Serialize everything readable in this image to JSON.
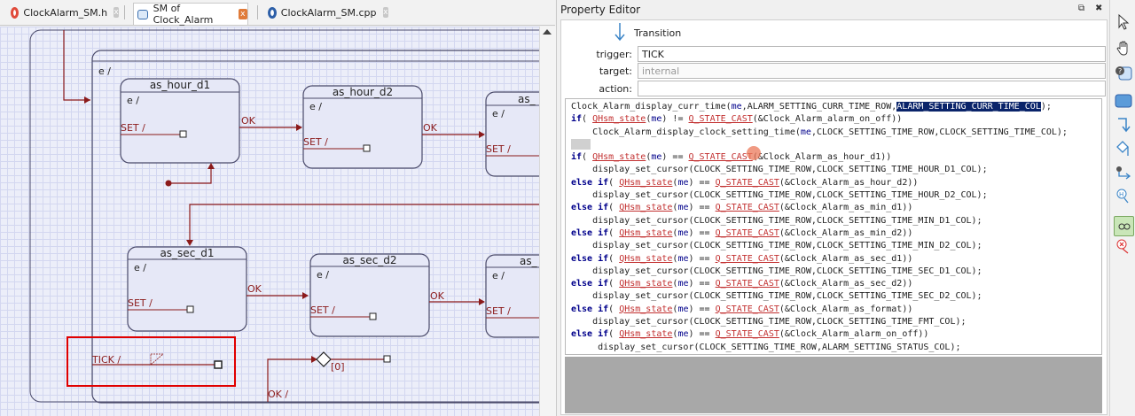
{
  "tabs": [
    {
      "label": "ClockAlarm_SM.h",
      "icon": "c-header-file-icon",
      "close": "x"
    },
    {
      "label": "SM of Clock_Alarm",
      "icon": "state-machine-icon",
      "close": "x"
    },
    {
      "label": "ClockAlarm_SM.cpp",
      "icon": "cpp-file-icon",
      "close": "x"
    }
  ],
  "diagram": {
    "outer_entry": "e /",
    "states": [
      {
        "name": "as_hour_d1",
        "entry": "e /",
        "set": "SET /"
      },
      {
        "name": "as_hour_d2",
        "entry": "e /",
        "set": "SET /"
      },
      {
        "name": "as_",
        "entry": "e /",
        "set": "SET /"
      },
      {
        "name": "as_sec_d1",
        "entry": "e /",
        "set": "SET /"
      },
      {
        "name": "as_sec_d2",
        "entry": "e /",
        "set": "SET /"
      },
      {
        "name": "as_",
        "entry": "e /",
        "set": "SET /"
      }
    ],
    "ok_labels": [
      "OK",
      "OK",
      "OK",
      "OK"
    ],
    "tick_label": "TICK /",
    "guard_label": "[0]",
    "bottom_label": "OK /"
  },
  "property_editor": {
    "title": "Property Editor",
    "restore": "⧉",
    "close": "✖",
    "element_type": "Transition",
    "trigger_label": "trigger:",
    "trigger_value": "TICK",
    "target_label": "target:",
    "target_value": "internal",
    "action_label": "action:",
    "action_value": ""
  },
  "code_lines": [
    [
      {
        "t": "Clock_Alarm_display_curr_time("
      },
      {
        "t": "me",
        "c": "me"
      },
      {
        "t": ",ALARM_SETTING_CURR_TIME_ROW,"
      },
      {
        "t": "ALARM_SETTING_CURR_TIME_COL",
        "c": "hl"
      },
      {
        "t": ");"
      }
    ],
    [
      {
        "t": "if",
        "c": "kw"
      },
      {
        "t": "( "
      },
      {
        "t": "QHsm_state",
        "c": "fn"
      },
      {
        "t": "("
      },
      {
        "t": "me",
        "c": "me"
      },
      {
        "t": ") != "
      },
      {
        "t": "Q_STATE_CAST",
        "c": "fn"
      },
      {
        "t": "(&Clock_Alarm_alarm_on_off))"
      }
    ],
    [
      {
        "t": "    Clock_Alarm_display_clock_setting_time("
      },
      {
        "t": "me",
        "c": "me"
      },
      {
        "t": ",CLOCK_SETTING_TIME_ROW,CLOCK_SETTING_TIME_COL);"
      }
    ],
    [
      {
        "t": "",
        "c": "blank"
      }
    ],
    [
      {
        "t": "if",
        "c": "kw"
      },
      {
        "t": "( "
      },
      {
        "t": "QHsm_state",
        "c": "fn"
      },
      {
        "t": "("
      },
      {
        "t": "me",
        "c": "me"
      },
      {
        "t": ") == "
      },
      {
        "t": "Q_STATE_CAST",
        "c": "fn"
      },
      {
        "t": "(&Clock_Alarm_as_hour_d1))"
      }
    ],
    [
      {
        "t": "    display_set_cursor(CLOCK_SETTING_TIME_ROW,CLOCK_SETTING_TIME_HOUR_D1_COL);"
      }
    ],
    [
      {
        "t": "else if",
        "c": "kw"
      },
      {
        "t": "( "
      },
      {
        "t": "QHsm_state",
        "c": "fn"
      },
      {
        "t": "("
      },
      {
        "t": "me",
        "c": "me"
      },
      {
        "t": ") == "
      },
      {
        "t": "Q_STATE_CAST",
        "c": "fn"
      },
      {
        "t": "(&Clock_Alarm_as_hour_d2))"
      }
    ],
    [
      {
        "t": "    display_set_cursor(CLOCK_SETTING_TIME_ROW,CLOCK_SETTING_TIME_HOUR_D2_COL);"
      }
    ],
    [
      {
        "t": "else if",
        "c": "kw"
      },
      {
        "t": "( "
      },
      {
        "t": "QHsm_state",
        "c": "fn"
      },
      {
        "t": "("
      },
      {
        "t": "me",
        "c": "me"
      },
      {
        "t": ") == "
      },
      {
        "t": "Q_STATE_CAST",
        "c": "fn"
      },
      {
        "t": "(&Clock_Alarm_as_min_d1))"
      }
    ],
    [
      {
        "t": "    display_set_cursor(CLOCK_SETTING_TIME_ROW,CLOCK_SETTING_TIME_MIN_D1_COL);"
      }
    ],
    [
      {
        "t": "else if",
        "c": "kw"
      },
      {
        "t": "( "
      },
      {
        "t": "QHsm_state",
        "c": "fn"
      },
      {
        "t": "("
      },
      {
        "t": "me",
        "c": "me"
      },
      {
        "t": ") == "
      },
      {
        "t": "Q_STATE_CAST",
        "c": "fn"
      },
      {
        "t": "(&Clock_Alarm_as_min_d2))"
      }
    ],
    [
      {
        "t": "    display_set_cursor(CLOCK_SETTING_TIME_ROW,CLOCK_SETTING_TIME_MIN_D2_COL);"
      }
    ],
    [
      {
        "t": "else if",
        "c": "kw"
      },
      {
        "t": "( "
      },
      {
        "t": "QHsm_state",
        "c": "fn"
      },
      {
        "t": "("
      },
      {
        "t": "me",
        "c": "me"
      },
      {
        "t": ") == "
      },
      {
        "t": "Q_STATE_CAST",
        "c": "fn"
      },
      {
        "t": "(&Clock_Alarm_as_sec_d1))"
      }
    ],
    [
      {
        "t": "    display_set_cursor(CLOCK_SETTING_TIME_ROW,CLOCK_SETTING_TIME_SEC_D1_COL);"
      }
    ],
    [
      {
        "t": "else if",
        "c": "kw"
      },
      {
        "t": "( "
      },
      {
        "t": "QHsm_state",
        "c": "fn"
      },
      {
        "t": "("
      },
      {
        "t": "me",
        "c": "me"
      },
      {
        "t": ") == "
      },
      {
        "t": "Q_STATE_CAST",
        "c": "fn"
      },
      {
        "t": "(&Clock_Alarm_as_sec_d2))"
      }
    ],
    [
      {
        "t": "    display_set_cursor(CLOCK_SETTING_TIME_ROW,CLOCK_SETTING_TIME_SEC_D2_COL);"
      }
    ],
    [
      {
        "t": "else if",
        "c": "kw"
      },
      {
        "t": "( "
      },
      {
        "t": "QHsm_state",
        "c": "fn"
      },
      {
        "t": "("
      },
      {
        "t": "me",
        "c": "me"
      },
      {
        "t": ") == "
      },
      {
        "t": "Q_STATE_CAST",
        "c": "fn"
      },
      {
        "t": "(&Clock_Alarm_as_format))"
      }
    ],
    [
      {
        "t": "    display_set_cursor(CLOCK_SETTING_TIME_ROW,CLOCK_SETTING_TIME_FMT_COL);"
      }
    ],
    [
      {
        "t": "else if",
        "c": "kw"
      },
      {
        "t": "( "
      },
      {
        "t": "QHsm_state",
        "c": "fn"
      },
      {
        "t": "("
      },
      {
        "t": "me",
        "c": "me"
      },
      {
        "t": ") == "
      },
      {
        "t": "Q_STATE_CAST",
        "c": "fn"
      },
      {
        "t": "(&Clock_Alarm_alarm_on_off))"
      }
    ],
    [
      {
        "t": "     display_set_cursor(CLOCK_SETTING_TIME_ROW,ALARM_SETTING_STATUS_COL);"
      }
    ]
  ],
  "tools": [
    "select-arrow-icon",
    "hand-pan-icon",
    "state-icon",
    "state-box-icon",
    "transition-icon",
    "choice-icon",
    "initial-transition-icon",
    "history-icon",
    "submachine-icon",
    "final-state-icon"
  ],
  "colors": {
    "accent": "#e07b39",
    "state_border": "#4a4a6a",
    "transition": "#8b1a1a",
    "selection_red": "#e00000",
    "code_keyword": "#00008b",
    "code_fn": "#c23030"
  }
}
